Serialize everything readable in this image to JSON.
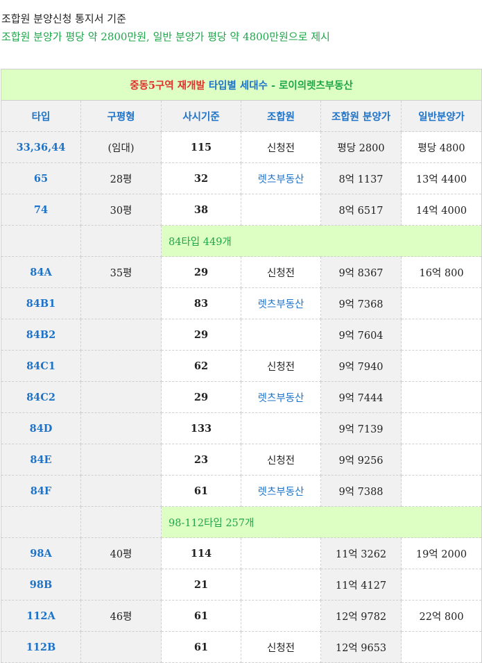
{
  "intro": {
    "line1": "조합원 분양신청 통지서 기준",
    "line2": "조합원 분양가 평당 약 2800만원, 일반 분양가 평당 약 4800만원으로 제시"
  },
  "table": {
    "title": {
      "part1": "중동5구역 재개발",
      "part2": "타입별 세대수",
      "part3": "- 로이의렛츠부동산"
    },
    "headers": [
      "타입",
      "구평형",
      "사시기준",
      "조합원",
      "조합원 분양가",
      "일반분양가"
    ],
    "rows": [
      {
        "kind": "data",
        "type": "33,36,44",
        "old": "(임대)",
        "std": "115",
        "member": "신청전",
        "member_link": false,
        "mprice": "평당 2800",
        "gprice": "평당 4800"
      },
      {
        "kind": "data",
        "type": "65",
        "old": "28평",
        "std": "32",
        "member": "렛츠부동산",
        "member_link": true,
        "mprice": "8억 1137",
        "gprice": "13억 4400"
      },
      {
        "kind": "data",
        "type": "74",
        "old": "30평",
        "std": "38",
        "member": "",
        "member_link": false,
        "mprice": "8억 6517",
        "gprice": "14억 4000"
      },
      {
        "kind": "group",
        "label": "84타입 449개"
      },
      {
        "kind": "data",
        "type": "84A",
        "old": "35평",
        "std": "29",
        "member": "신청전",
        "member_link": false,
        "mprice": "9억 8367",
        "gprice": "16억 800"
      },
      {
        "kind": "data",
        "type": "84B1",
        "old": "",
        "std": "83",
        "member": "렛츠부동산",
        "member_link": true,
        "mprice": "9억 7368",
        "gprice": ""
      },
      {
        "kind": "data",
        "type": "84B2",
        "old": "",
        "std": "29",
        "member": "",
        "member_link": false,
        "mprice": "9억 7604",
        "gprice": ""
      },
      {
        "kind": "data",
        "type": "84C1",
        "old": "",
        "std": "62",
        "member": "신청전",
        "member_link": false,
        "mprice": "9억 7940",
        "gprice": ""
      },
      {
        "kind": "data",
        "type": "84C2",
        "old": "",
        "std": "29",
        "member": "렛츠부동산",
        "member_link": true,
        "mprice": "9억 7444",
        "gprice": ""
      },
      {
        "kind": "data",
        "type": "84D",
        "old": "",
        "std": "133",
        "member": "",
        "member_link": false,
        "mprice": "9억 7139",
        "gprice": ""
      },
      {
        "kind": "data",
        "type": "84E",
        "old": "",
        "std": "23",
        "member": "신청전",
        "member_link": false,
        "mprice": "9억 9256",
        "gprice": ""
      },
      {
        "kind": "data",
        "type": "84F",
        "old": "",
        "std": "61",
        "member": "렛츠부동산",
        "member_link": true,
        "mprice": "9억 7388",
        "gprice": ""
      },
      {
        "kind": "group",
        "label": "98-112타입  257개"
      },
      {
        "kind": "data",
        "type": "98A",
        "old": "40평",
        "std": "114",
        "member": "",
        "member_link": false,
        "mprice": "11억 3262",
        "gprice": "19억 2000"
      },
      {
        "kind": "data",
        "type": "98B",
        "old": "",
        "std": "21",
        "member": "",
        "member_link": false,
        "mprice": "11억 4127",
        "gprice": ""
      },
      {
        "kind": "data",
        "type": "112A",
        "old": "46평",
        "std": "61",
        "member": "",
        "member_link": false,
        "mprice": "12억 9782",
        "gprice": "22억 800"
      },
      {
        "kind": "data",
        "type": "112B",
        "old": "",
        "std": "61",
        "member": "신청전",
        "member_link": false,
        "mprice": "12억 9653",
        "gprice": ""
      }
    ]
  },
  "colors": {
    "accent_blue": "#1e73c8",
    "accent_green": "#1fa54a",
    "accent_red": "#e0322d",
    "highlight_bg": "#deffc3",
    "shaded_bg": "#f1f1f1"
  }
}
